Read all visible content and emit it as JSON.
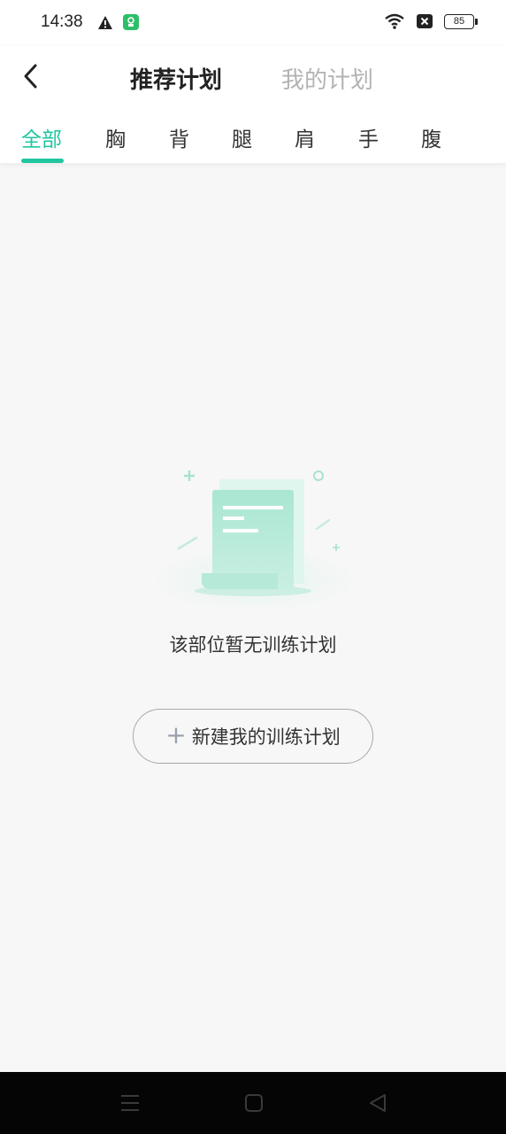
{
  "status_bar": {
    "time": "14:38",
    "icons": [
      "warning-icon",
      "app-notification-icon",
      "wifi-icon",
      "no-sim-icon"
    ],
    "battery": "85"
  },
  "header": {
    "tabs": [
      {
        "label": "推荐计划",
        "active": true
      },
      {
        "label": "我的计划",
        "active": false
      }
    ]
  },
  "categories": [
    {
      "label": "全部",
      "active": true
    },
    {
      "label": "胸",
      "active": false
    },
    {
      "label": "背",
      "active": false
    },
    {
      "label": "腿",
      "active": false
    },
    {
      "label": "肩",
      "active": false
    },
    {
      "label": "手",
      "active": false
    },
    {
      "label": "腹",
      "active": false
    }
  ],
  "empty_state": {
    "message": "该部位暂无训练计划",
    "button_label": "新建我的训练计划",
    "button_icon": "+"
  },
  "colors": {
    "accent": "#20c6a0",
    "inactive_tab": "#b3b3b3",
    "background": "#f7f7f7"
  }
}
